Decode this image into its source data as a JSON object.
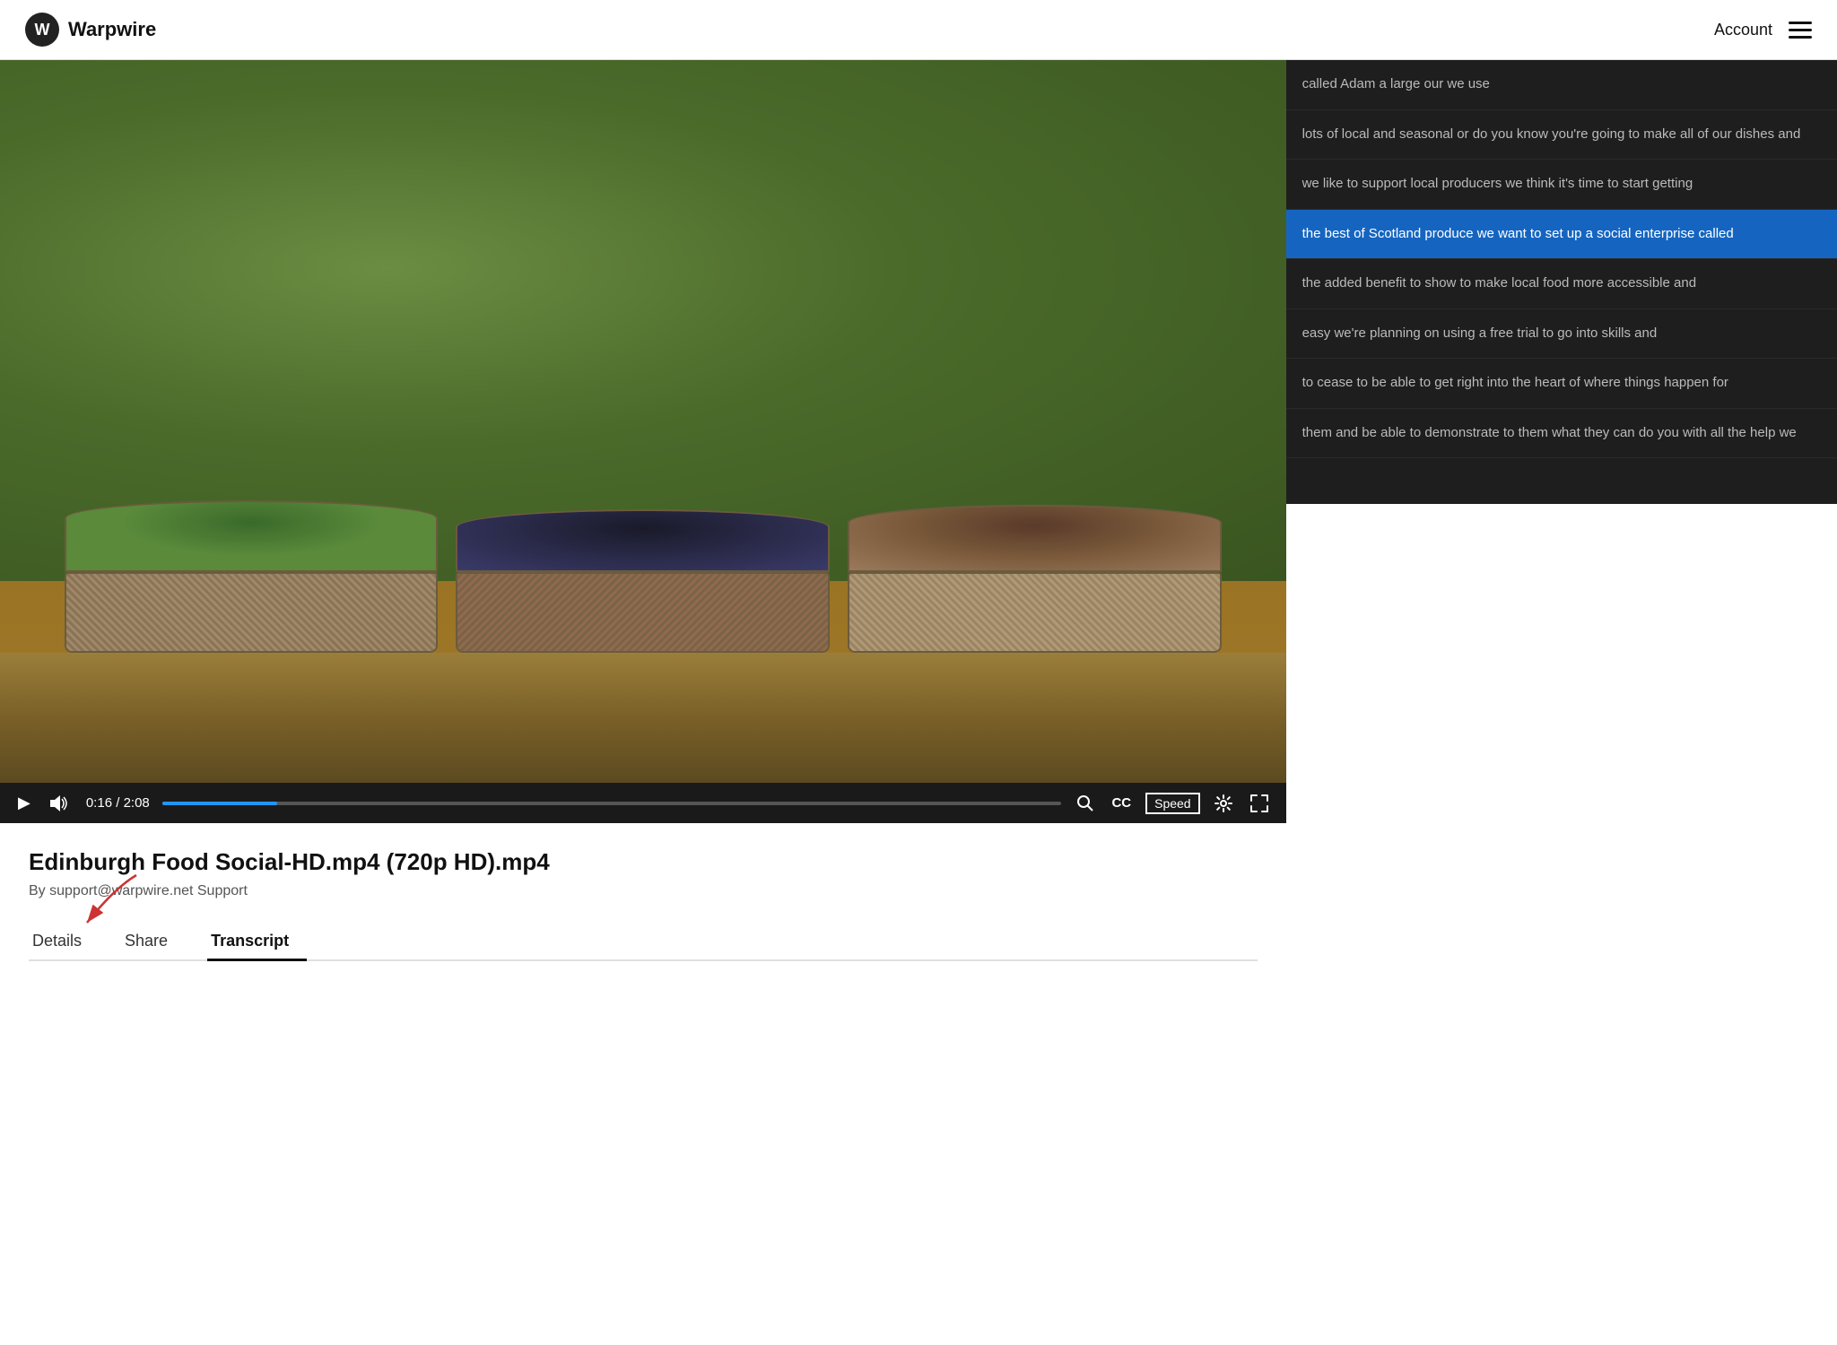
{
  "header": {
    "logo_letter": "W",
    "brand_name": "Warpwire",
    "account_label": "Account"
  },
  "video": {
    "title": "Edinburgh Food Social-HD.mp4 (720p HD).mp4",
    "author": "By support@warpwire.net Support",
    "current_time": "0:16",
    "total_time": "2:08",
    "progress_percent": 12.8,
    "controls": {
      "play": "▶",
      "volume": "🔊",
      "search_icon": "search",
      "cc_label": "CC",
      "speed_label": "Speed",
      "settings_icon": "gear",
      "fullscreen_icon": "fullscreen"
    }
  },
  "transcript": {
    "items": [
      {
        "id": 1,
        "text": "called Adam a large our we use",
        "active": false
      },
      {
        "id": 2,
        "text": "lots of local and seasonal or do you know you're going to make all of our dishes and",
        "active": false
      },
      {
        "id": 3,
        "text": "we like to support local producers we think it's time to start getting",
        "active": false
      },
      {
        "id": 4,
        "text": "the best of Scotland produce we want to set up a social enterprise called",
        "active": true
      },
      {
        "id": 5,
        "text": "the added benefit to show to make local food more accessible and",
        "active": false
      },
      {
        "id": 6,
        "text": "easy we're planning on using a free trial to go into skills and",
        "active": false
      },
      {
        "id": 7,
        "text": "to cease to be able to get right into the heart of where things happen for",
        "active": false
      },
      {
        "id": 8,
        "text": "them and be able to demonstrate to them what they can do you with all the help we",
        "active": false
      }
    ]
  },
  "tabs": [
    {
      "id": "details",
      "label": "Details",
      "active": false
    },
    {
      "id": "share",
      "label": "Share",
      "active": false
    },
    {
      "id": "transcript",
      "label": "Transcript",
      "active": true
    }
  ],
  "annotation": {
    "arrow_color": "#cc3333"
  }
}
